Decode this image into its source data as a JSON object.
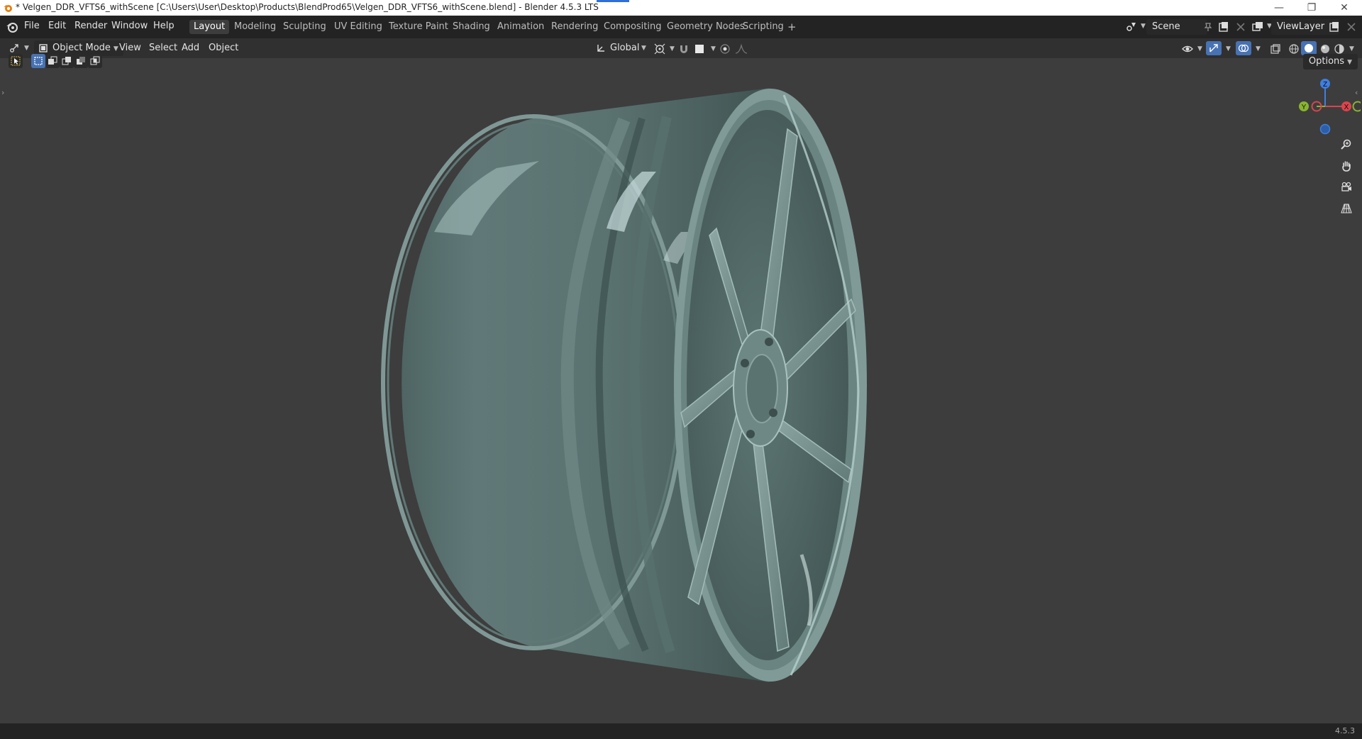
{
  "window": {
    "title": "* Velgen_DDR_VFTS6_withScene [C:\\Users\\User\\Desktop\\Products\\BlendProd65\\Velgen_DDR_VFTS6_withScene.blend] - Blender 4.5.3 LTS",
    "app_icon": "blender-icon",
    "controls": [
      "minimize-icon",
      "restore-icon",
      "close-icon"
    ]
  },
  "menu": {
    "items": [
      {
        "label": "File"
      },
      {
        "label": "Edit"
      },
      {
        "label": "Render"
      },
      {
        "label": "Window"
      },
      {
        "label": "Help"
      }
    ]
  },
  "workspaces": {
    "tabs": [
      {
        "label": "Layout",
        "active": true
      },
      {
        "label": "Modeling"
      },
      {
        "label": "Sculpting"
      },
      {
        "label": "UV Editing"
      },
      {
        "label": "Texture Paint"
      },
      {
        "label": "Shading"
      },
      {
        "label": "Animation"
      },
      {
        "label": "Rendering"
      },
      {
        "label": "Compositing"
      },
      {
        "label": "Geometry Nodes"
      },
      {
        "label": "Scripting"
      }
    ],
    "add_label": "+"
  },
  "scene": {
    "name": "Scene"
  },
  "view_layer": {
    "name": "ViewLayer"
  },
  "header": {
    "mode": "Object Mode",
    "view": "View",
    "select": "Select",
    "add": "Add",
    "object": "Object",
    "orientation": "Global"
  },
  "viewport": {
    "options_label": "Options",
    "gizmo": {
      "z": "Z",
      "x": "X",
      "y": "Y"
    },
    "nav_icons": [
      "zoom-icon",
      "pan-hand-icon",
      "camera-icon",
      "grid-icon"
    ]
  },
  "status": {
    "version": "4.5.3"
  },
  "colors": {
    "accent": "#4772b3",
    "axis_x": "#d8454f",
    "axis_y": "#8ab430",
    "axis_z": "#3f7fde",
    "wheel": "#6a8785",
    "background": "#3d3d3d"
  }
}
